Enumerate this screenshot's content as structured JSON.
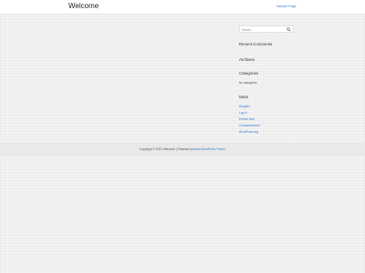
{
  "header": {
    "site_title": "Welcome",
    "nav": {
      "sample_page": "Sample Page"
    }
  },
  "sidebar": {
    "search": {
      "placeholder": "Search ...",
      "icon": "search-icon"
    },
    "recent_comments_title": "Recent Comments",
    "archives_title": "Archives",
    "categories_title": "Categories",
    "categories_empty": "No categories",
    "meta_title": "Meta",
    "meta_links": [
      "Register",
      "Log in",
      "Entries feed",
      "Comments feed",
      "WordPress.org"
    ]
  },
  "footer": {
    "prefix": "Copyright © 2021 Welcome | Powered by ",
    "theme_link": "Astra WordPress Theme"
  }
}
